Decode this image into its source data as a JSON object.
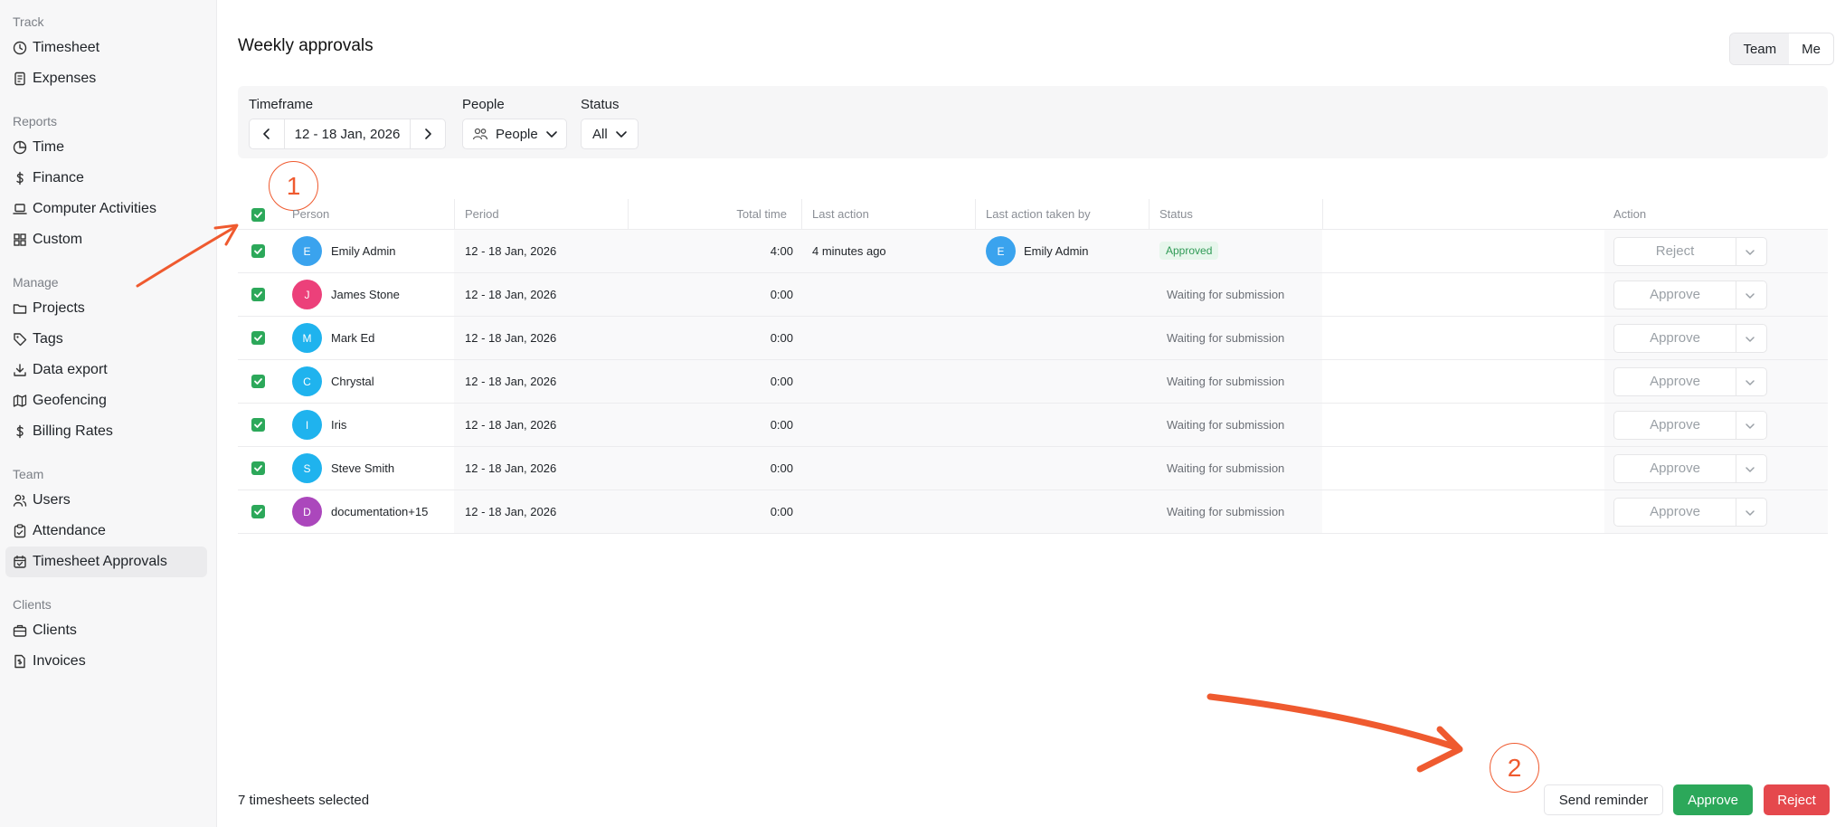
{
  "sidebar": {
    "sections": [
      {
        "label": "Track",
        "items": [
          {
            "label": "Timesheet",
            "icon": "clock-icon"
          },
          {
            "label": "Expenses",
            "icon": "receipt-icon"
          }
        ]
      },
      {
        "label": "Reports",
        "items": [
          {
            "label": "Time",
            "icon": "pie-chart-icon"
          },
          {
            "label": "Finance",
            "icon": "dollar-icon"
          },
          {
            "label": "Computer Activities",
            "icon": "laptop-icon"
          },
          {
            "label": "Custom",
            "icon": "grid-icon"
          }
        ]
      },
      {
        "label": "Manage",
        "items": [
          {
            "label": "Projects",
            "icon": "folder-icon"
          },
          {
            "label": "Tags",
            "icon": "tag-icon"
          },
          {
            "label": "Data export",
            "icon": "download-icon"
          },
          {
            "label": "Geofencing",
            "icon": "map-icon"
          },
          {
            "label": "Billing Rates",
            "icon": "dollar-icon"
          }
        ]
      },
      {
        "label": "Team",
        "items": [
          {
            "label": "Users",
            "icon": "users-icon"
          },
          {
            "label": "Attendance",
            "icon": "clipboard-icon"
          },
          {
            "label": "Timesheet Approvals",
            "icon": "calendar-check-icon",
            "active": true
          }
        ]
      },
      {
        "label": "Clients",
        "items": [
          {
            "label": "Clients",
            "icon": "briefcase-icon"
          },
          {
            "label": "Invoices",
            "icon": "invoice-icon"
          }
        ]
      }
    ]
  },
  "header": {
    "title": "Weekly approvals",
    "toggle": {
      "team": "Team",
      "me": "Me",
      "selected": "Team"
    }
  },
  "filters": {
    "timeframe_label": "Timeframe",
    "timeframe_value": "12 - 18 Jan, 2026",
    "people_label": "People",
    "people_value": "People",
    "status_label": "Status",
    "status_value": "All"
  },
  "annotations": {
    "marker1": "1",
    "marker2": "2",
    "color": "#ef5a2f"
  },
  "table": {
    "columns": {
      "person": "Person",
      "period": "Period",
      "total_time": "Total time",
      "last_action": "Last action",
      "last_action_by": "Last action taken by",
      "status": "Status",
      "action": "Action"
    },
    "rows": [
      {
        "initial": "E",
        "name": "Emily Admin",
        "color": "#3aa3ee",
        "period": "12 - 18 Jan, 2026",
        "total": "4:00",
        "last_action": "4 minutes ago",
        "by_initial": "E",
        "by_name": "Emily Admin",
        "status": "Approved",
        "action": "Reject"
      },
      {
        "initial": "J",
        "name": "James Stone",
        "color": "#ec407a",
        "period": "12 - 18 Jan, 2026",
        "total": "0:00",
        "last_action": "",
        "by_initial": "",
        "by_name": "",
        "status": "Waiting for submission",
        "action": "Approve"
      },
      {
        "initial": "M",
        "name": "Mark Ed",
        "color": "#1fb3ee",
        "period": "12 - 18 Jan, 2026",
        "total": "0:00",
        "last_action": "",
        "by_initial": "",
        "by_name": "",
        "status": "Waiting for submission",
        "action": "Approve"
      },
      {
        "initial": "C",
        "name": "Chrystal",
        "color": "#1fb3ee",
        "period": "12 - 18 Jan, 2026",
        "total": "0:00",
        "last_action": "",
        "by_initial": "",
        "by_name": "",
        "status": "Waiting for submission",
        "action": "Approve"
      },
      {
        "initial": "I",
        "name": "Iris",
        "color": "#1fb3ee",
        "period": "12 - 18 Jan, 2026",
        "total": "0:00",
        "last_action": "",
        "by_initial": "",
        "by_name": "",
        "status": "Waiting for submission",
        "action": "Approve"
      },
      {
        "initial": "S",
        "name": "Steve Smith",
        "color": "#1fb3ee",
        "period": "12 - 18 Jan, 2026",
        "total": "0:00",
        "last_action": "",
        "by_initial": "",
        "by_name": "",
        "status": "Waiting for submission",
        "action": "Approve"
      },
      {
        "initial": "D",
        "name": "documentation+15",
        "color": "#ab47bc",
        "period": "12 - 18 Jan, 2026",
        "total": "0:00",
        "last_action": "",
        "by_initial": "",
        "by_name": "",
        "status": "Waiting for submission",
        "action": "Approve"
      }
    ]
  },
  "footer": {
    "selected_text": "7 timesheets selected",
    "send_reminder": "Send reminder",
    "approve": "Approve",
    "reject": "Reject",
    "approve_color": "#2ca85a",
    "reject_color": "#e5484d"
  }
}
